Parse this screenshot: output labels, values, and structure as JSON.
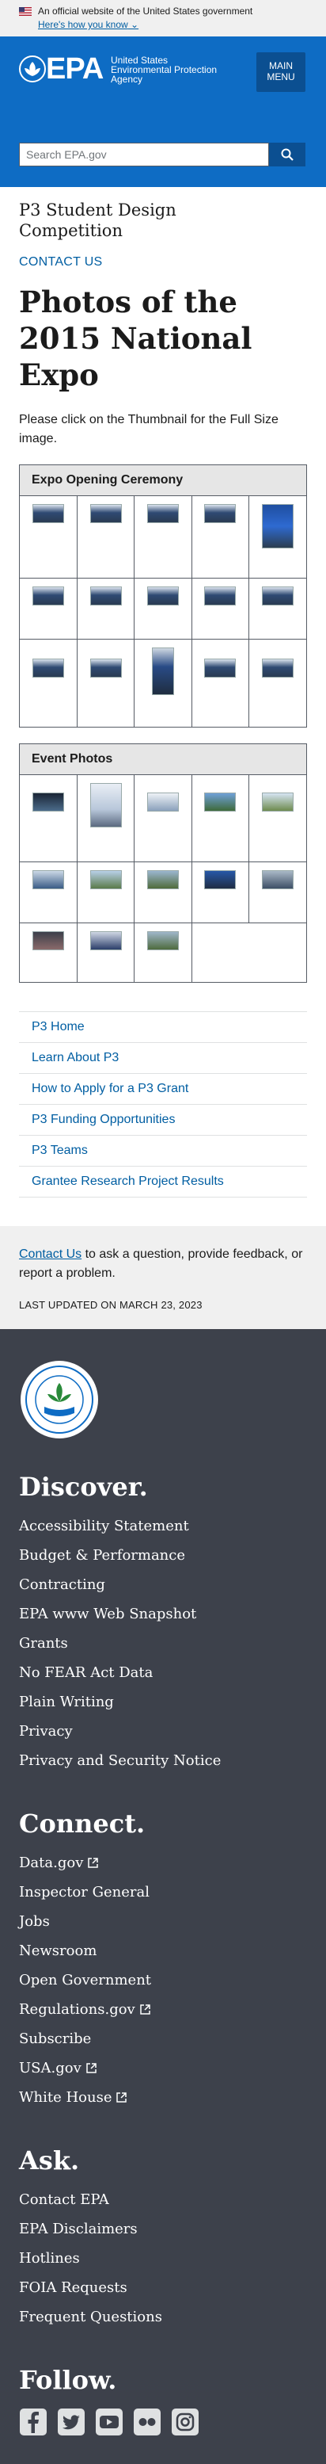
{
  "banner": {
    "official_text": "An official website of the United States government",
    "how_text": "Here's how you know"
  },
  "header": {
    "logo_text": "EPA",
    "agency_line1": "United States",
    "agency_line2": "Environmental Protection",
    "agency_line3": "Agency",
    "menu_line1": "MAIN",
    "menu_line2": "MENU",
    "search_placeholder": "Search EPA.gov"
  },
  "page": {
    "site_title": "P3 Student Design Competition",
    "contact_label": "CONTACT US",
    "title": "Photos of the 2015 National Expo",
    "intro": "Please click on the Thumbnail for the Full Size image."
  },
  "galleries": [
    {
      "caption": "Expo Opening Ceremony"
    },
    {
      "caption": "Event Photos"
    }
  ],
  "side_nav": [
    "P3 Home",
    "Learn About P3",
    "How to Apply for a P3 Grant",
    "P3 Funding Opportunities",
    "P3 Teams",
    "Grantee Research Project Results"
  ],
  "contact_box": {
    "link": "Contact Us",
    "text": " to ask a question, provide feedback, or report a problem.",
    "updated": "LAST UPDATED ON MARCH 23, 2023"
  },
  "footer": {
    "discover": {
      "heading": "Discover.",
      "items": [
        "Accessibility Statement",
        "Budget & Performance",
        "Contracting",
        "EPA www Web Snapshot",
        "Grants",
        "No FEAR Act Data",
        "Plain Writing",
        "Privacy",
        "Privacy and Security Notice"
      ]
    },
    "connect": {
      "heading": "Connect.",
      "items": [
        "Data.gov",
        "Inspector General",
        "Jobs",
        "Newsroom",
        "Open Government",
        "Regulations.gov",
        "Subscribe",
        "USA.gov",
        "White House"
      ]
    },
    "ask": {
      "heading": "Ask.",
      "items": [
        "Contact EPA",
        "EPA Disclaimers",
        "Hotlines",
        "FOIA Requests",
        "Frequent Questions"
      ]
    },
    "follow": {
      "heading": "Follow.",
      "icons": [
        "facebook-icon",
        "twitter-icon",
        "youtube-icon",
        "flickr-icon",
        "instagram-icon"
      ]
    }
  },
  "colors": {
    "header_blue": "#0e6cc4",
    "link_blue": "#005ea2",
    "footer_bg": "#3d414b"
  }
}
